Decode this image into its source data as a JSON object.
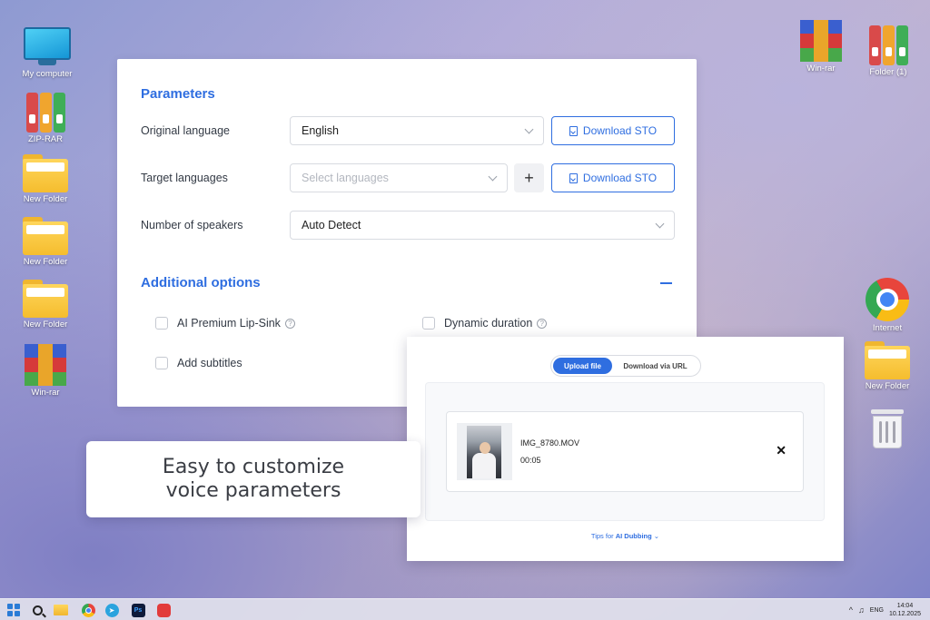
{
  "desktop": {
    "left_icons": [
      {
        "label": "My computer",
        "icon": "computer-icon"
      },
      {
        "label": "ZIP-RAR",
        "icon": "archive-books-icon"
      },
      {
        "label": "New Folder",
        "icon": "folder-icon"
      },
      {
        "label": "New Folder",
        "icon": "folder-icon"
      },
      {
        "label": "New Folder",
        "icon": "folder-icon"
      },
      {
        "label": "Win-rar",
        "icon": "winrar-icon"
      }
    ],
    "right_icons": [
      {
        "label": "Win-rar",
        "icon": "winrar-icon"
      },
      {
        "label": "Folder (1)",
        "icon": "archive-books-icon"
      },
      {
        "label": "Internet",
        "icon": "chrome-icon"
      },
      {
        "label": "New Folder",
        "icon": "folder-icon"
      },
      {
        "label": "",
        "icon": "recycle-bin-icon"
      }
    ]
  },
  "parameters": {
    "title": "Parameters",
    "original_language": {
      "label": "Original language",
      "value": "English",
      "button": "Download STO"
    },
    "target_languages": {
      "label": "Target languages",
      "placeholder": "Select languages",
      "add": "+",
      "button": "Download STO"
    },
    "speakers": {
      "label": "Number of speakers",
      "value": "Auto Detect"
    }
  },
  "additional": {
    "title": "Additional options",
    "options": [
      {
        "label": "AI Premium Lip-Sink",
        "checked": false,
        "help": "?"
      },
      {
        "label": "Dynamic duration",
        "checked": false,
        "help": "?"
      },
      {
        "label": "Add subtitles",
        "checked": false
      }
    ]
  },
  "upload": {
    "tabs": [
      "Upload file",
      "Download via URL"
    ],
    "active_tab": "Upload file",
    "file": {
      "name": "IMG_8780.MOV",
      "duration": "00:05",
      "remove": "✕"
    },
    "tips_prefix": "Tips for ",
    "tips_bold": "AI Dubbing",
    "tips_chevron": "⌄"
  },
  "caption": {
    "line1": "Easy to customize",
    "line2": "voice parameters"
  },
  "taskbar": {
    "ps_label": "Ps",
    "telegram_glyph": "➤",
    "language": "ENG",
    "time": "14:04",
    "date": "10.12.2025",
    "tray_chevron": "^",
    "tray_bell": "♫"
  },
  "colors": {
    "accent": "#2f6ee0"
  }
}
